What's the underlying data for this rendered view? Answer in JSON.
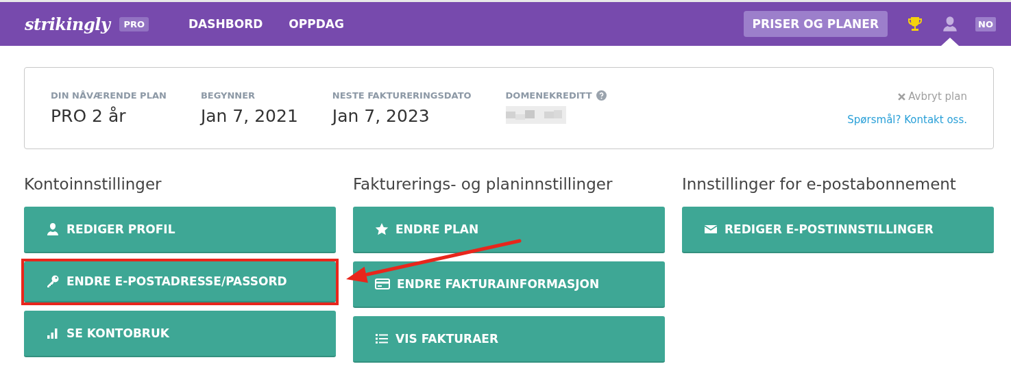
{
  "topbar": {
    "logo": "strikingly",
    "plan_badge": "PRO",
    "nav": [
      {
        "label": "DASHBORD",
        "selected": false
      },
      {
        "label": "OPPDAG",
        "selected": false
      }
    ],
    "pricing_button": "PRISER OG PLANER",
    "language": "NO"
  },
  "plan_card": {
    "fields": [
      {
        "label": "DIN NÅVÆRENDE PLAN",
        "value": "PRO 2 år"
      },
      {
        "label": "BEGYNNER",
        "value": "Jan 7, 2021"
      },
      {
        "label": "NESTE FAKTURERINGSDATO",
        "value": "Jan 7, 2023"
      },
      {
        "label": "DOMENEKREDITT",
        "value_blurred": true,
        "help": true
      }
    ],
    "cancel_link": "Avbryt plan",
    "contact_link": "Spørsmål? Kontakt oss."
  },
  "sections": [
    {
      "title": "Kontoinnstillinger",
      "buttons": [
        {
          "label": "REDIGER PROFIL",
          "highlighted": false
        },
        {
          "label": "ENDRE E-POSTADRESSE/PASSORD",
          "highlighted": true
        },
        {
          "label": "SE KONTOBRUK",
          "highlighted": false
        }
      ]
    },
    {
      "title": "Fakturerings- og planinnstillinger",
      "buttons": [
        {
          "label": "ENDRE PLAN",
          "highlighted": false
        },
        {
          "label": "ENDRE FAKTURAINFORMASJON",
          "highlighted": false
        },
        {
          "label": "VIS FAKTURAER",
          "highlighted": false
        }
      ]
    },
    {
      "title": "Innstillinger for e-postabonnement",
      "buttons": [
        {
          "label": "REDIGER E-POSTINNSTILLINGER",
          "highlighted": false
        }
      ]
    }
  ],
  "annotation": {
    "arrow": true
  }
}
